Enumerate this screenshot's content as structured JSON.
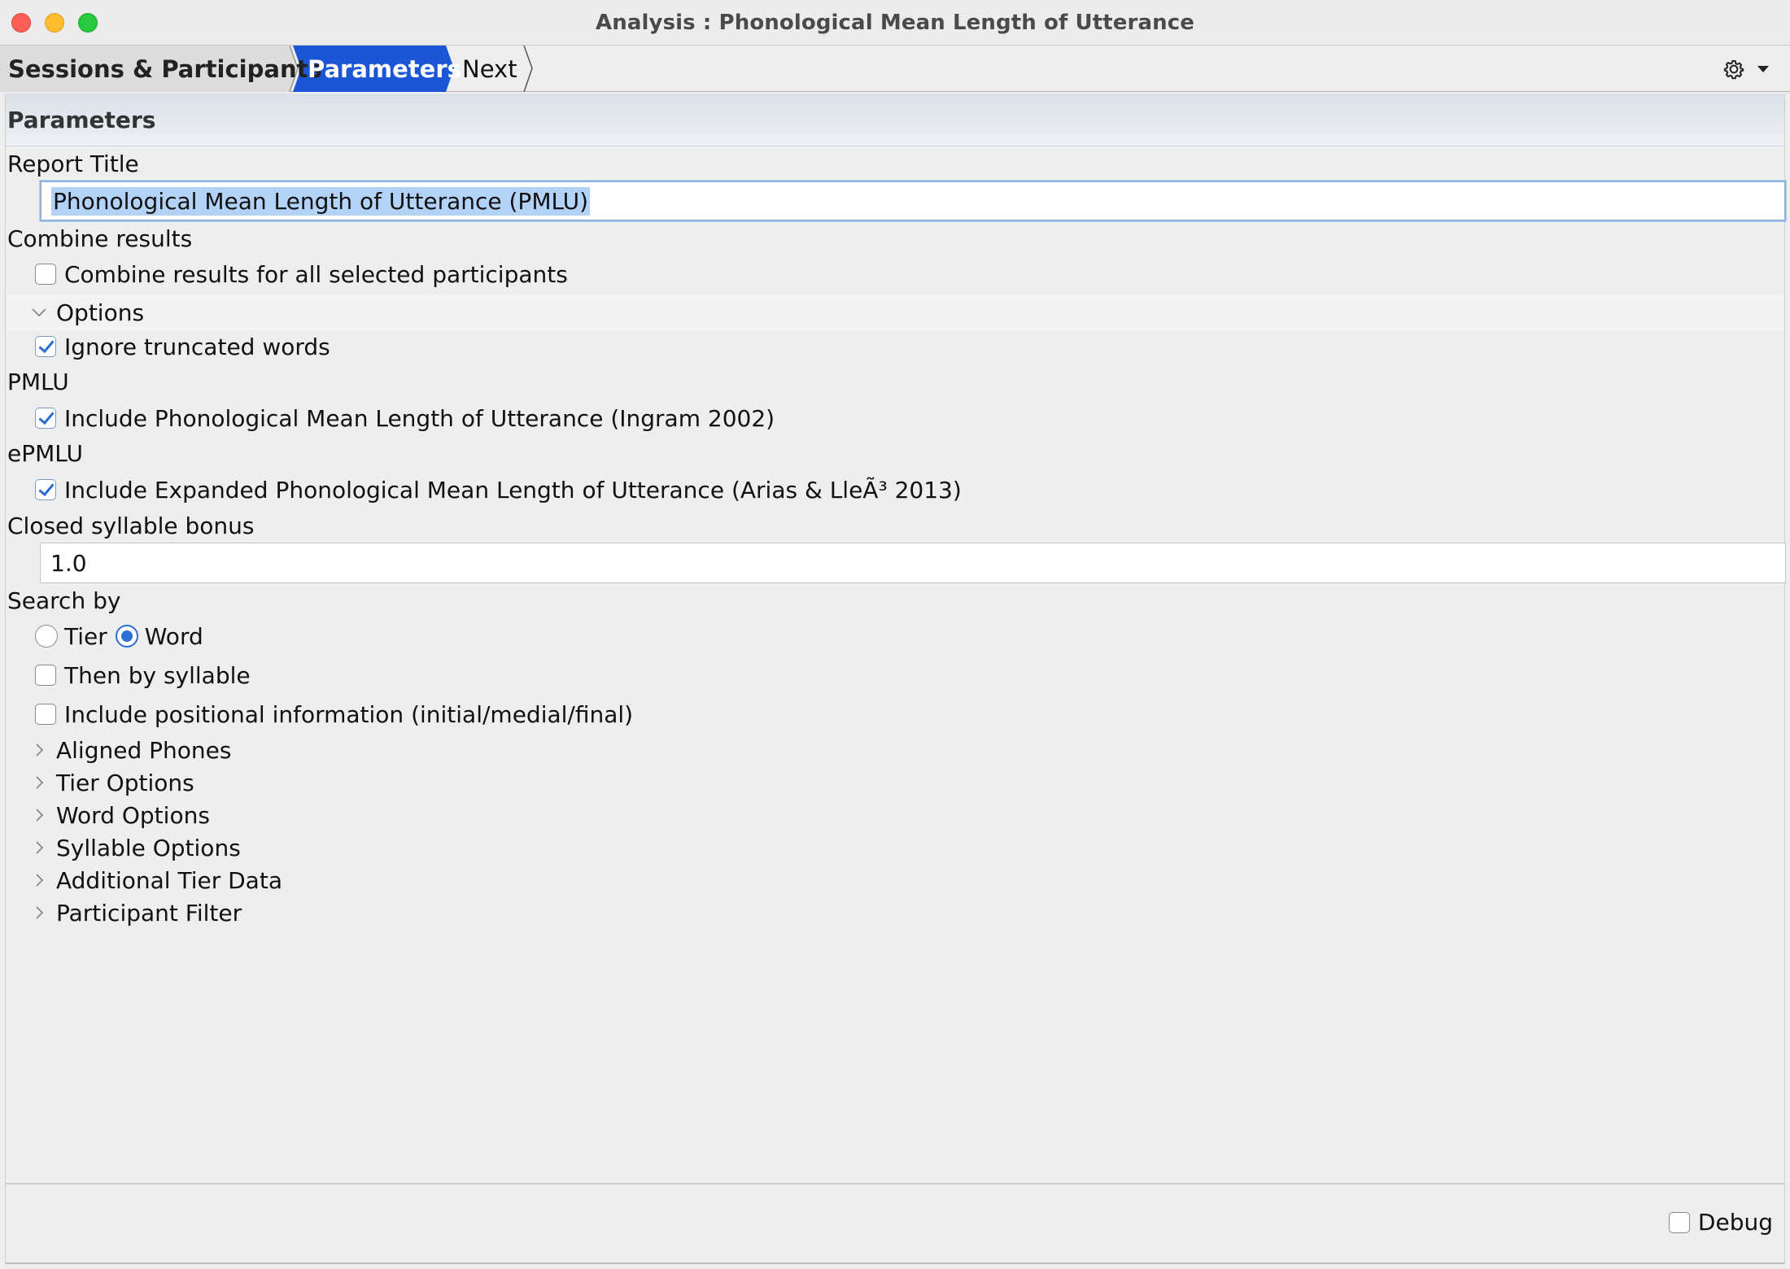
{
  "window": {
    "title": "Analysis : Phonological Mean Length of Utterance"
  },
  "breadcrumb": {
    "items": [
      "Sessions & Participants",
      "Parameters",
      "Next"
    ],
    "active_color": "#1a56d6"
  },
  "toolbar": {
    "settings_icon": "gear-icon",
    "menu_icon": "caret-down-icon"
  },
  "panel": {
    "header": "Parameters",
    "report_title_label": "Report Title",
    "report_title_value": "Phonological Mean Length of Utterance (PMLU)",
    "combine_label": "Combine results",
    "combine_checkbox": "Combine results for all selected participants",
    "combine_checked": false,
    "options_label": "Options",
    "ignore_truncated": "Ignore truncated words",
    "ignore_truncated_checked": true,
    "pmlu_label": "PMLU",
    "pmlu_checkbox": "Include Phonological Mean Length of Utterance (Ingram 2002)",
    "pmlu_checked": true,
    "epmlu_label": "ePMLU",
    "epmlu_checkbox": "Include Expanded Phonological Mean Length of Utterance (Arias & LleÃ³ 2013)",
    "epmlu_checked": true,
    "closed_syllable_label": "Closed syllable bonus",
    "closed_syllable_value": "1.0",
    "search_by_label": "Search by",
    "search_options": [
      "Tier",
      "Word"
    ],
    "search_selected": "Word",
    "then_by_syllable": "Then by syllable",
    "then_by_syllable_checked": false,
    "positional_info": "Include positional information (initial/medial/final)",
    "positional_info_checked": false,
    "sections": [
      "Aligned Phones",
      "Tier Options",
      "Word Options",
      "Syllable Options",
      "Additional Tier Data",
      "Participant Filter"
    ]
  },
  "footer": {
    "debug_label": "Debug",
    "debug_checked": false
  }
}
